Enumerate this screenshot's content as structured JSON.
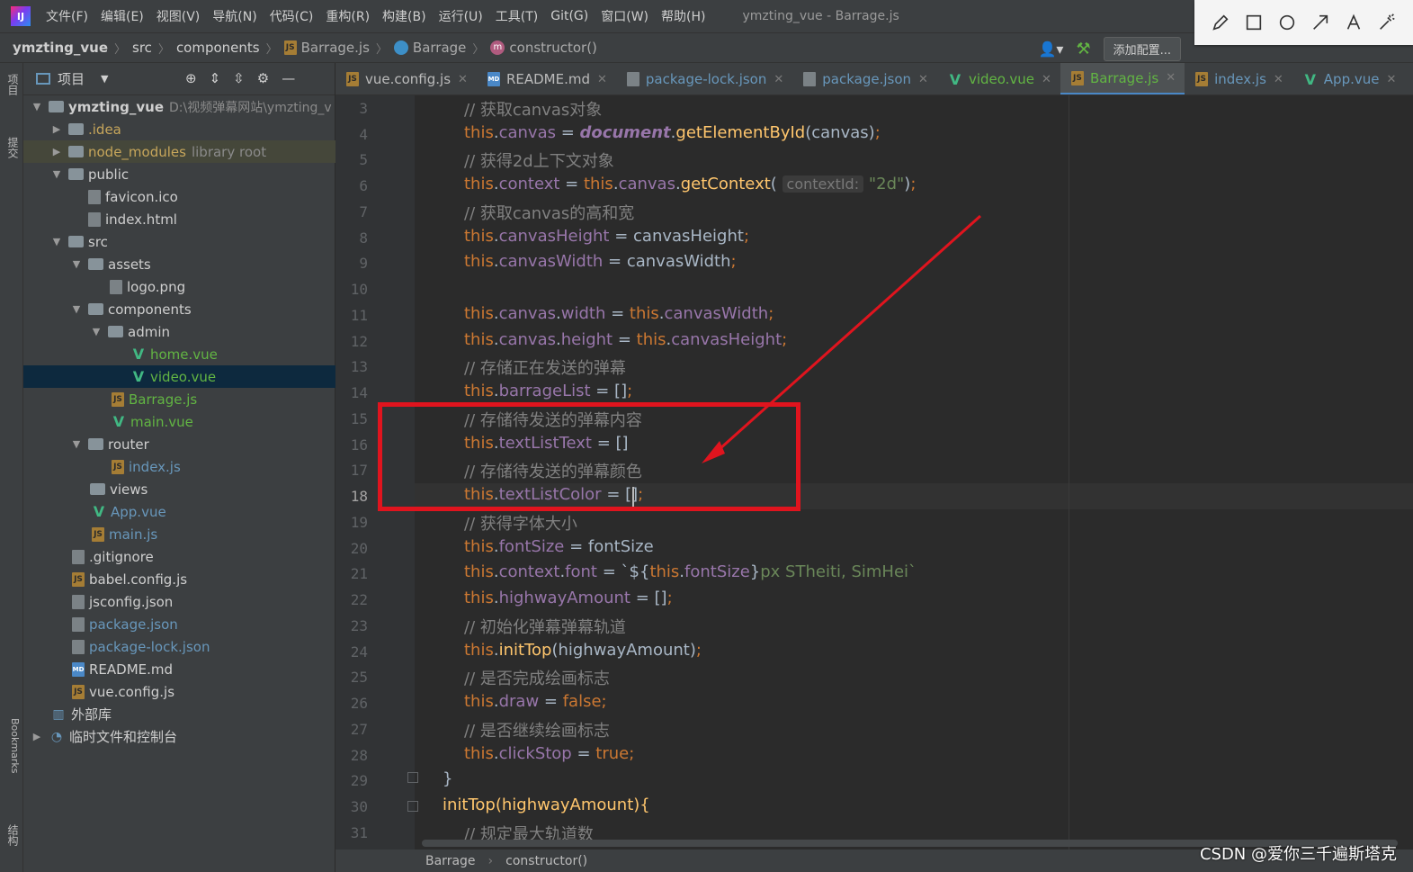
{
  "menubar": {
    "items": [
      "文件(F)",
      "编辑(E)",
      "视图(V)",
      "导航(N)",
      "代码(C)",
      "重构(R)",
      "构建(B)",
      "运行(U)",
      "工具(T)",
      "Git(G)",
      "窗口(W)",
      "帮助(H)"
    ],
    "window_title": "ymzting_vue - Barrage.js"
  },
  "navbar": {
    "crumbs": [
      "ymzting_vue",
      "src",
      "components",
      "Barrage.js",
      "Barrage",
      "constructor()"
    ],
    "add_config": "添加配置..."
  },
  "left_strip": {
    "project": "项目",
    "commit": "提交",
    "bookmarks": "Bookmarks",
    "structure": "结构"
  },
  "project_panel": {
    "title": "项目",
    "tree": [
      {
        "label": "ymzting_vue",
        "extra": "D:\\视频弹幕网站\\ymzting_v"
      },
      {
        "label": ".idea"
      },
      {
        "label": "node_modules",
        "extra": "library root"
      },
      {
        "label": "public"
      },
      {
        "label": "favicon.ico"
      },
      {
        "label": "index.html"
      },
      {
        "label": "src"
      },
      {
        "label": "assets"
      },
      {
        "label": "logo.png"
      },
      {
        "label": "components"
      },
      {
        "label": "admin"
      },
      {
        "label": "home.vue"
      },
      {
        "label": "video.vue"
      },
      {
        "label": "Barrage.js"
      },
      {
        "label": "main.vue"
      },
      {
        "label": "router"
      },
      {
        "label": "index.js"
      },
      {
        "label": "views"
      },
      {
        "label": "App.vue"
      },
      {
        "label": "main.js"
      },
      {
        "label": ".gitignore"
      },
      {
        "label": "babel.config.js"
      },
      {
        "label": "jsconfig.json"
      },
      {
        "label": "package.json"
      },
      {
        "label": "package-lock.json"
      },
      {
        "label": "README.md"
      },
      {
        "label": "vue.config.js"
      },
      {
        "label": "外部库"
      },
      {
        "label": "临时文件和控制台"
      }
    ]
  },
  "tabs": [
    "vue.config.js",
    "README.md",
    "package-lock.json",
    "package.json",
    "video.vue",
    "Barrage.js",
    "index.js",
    "App.vue"
  ],
  "editor": {
    "line_numbers": [
      "3",
      "4",
      "5",
      "6",
      "7",
      "8",
      "9",
      "10",
      "11",
      "12",
      "13",
      "14",
      "15",
      "16",
      "17",
      "18",
      "19",
      "20",
      "21",
      "22",
      "23",
      "24",
      "25",
      "26",
      "27",
      "28",
      "29",
      "30",
      "31"
    ],
    "comments": {
      "c3": "// 获取canvas对象",
      "c5": "// 获得2d上下文对象",
      "c7": "// 获取canvas的高和宽",
      "c13": "// 存储正在发送的弹幕",
      "c15": "// 存储待发送的弹幕内容",
      "c17": "// 存储待发送的弹幕颜色",
      "c19": "// 获得字体大小",
      "c23": "// 初始化弹幕弹幕轨道",
      "c25": "// 是否完成绘画标志",
      "c27": "// 是否继续绘画标志",
      "c31": "// 规定最大轨道数"
    },
    "tokens": {
      "this": "this",
      "canvas": "canvas",
      "document": "document",
      "getElementById": "getElementById",
      "canvasArg": "canvas",
      "context": "context",
      "getContext": "getContext",
      "contextIdHint": "contextId:",
      "str2d": "\"2d\"",
      "canvasHeight": "canvasHeight",
      "canvasWidth": "canvasWidth",
      "width": "width",
      "height": "height",
      "barrageList": "barrageList",
      "textListText": "textListText",
      "textListColor": "textListColor",
      "fontSize": "fontSize",
      "font": "font",
      "tplOpen": "`${",
      "tplClose": "}",
      "tplRest": "px STheiti, SimHei`",
      "highwayAmount": "highwayAmount",
      "initTop": "initTop",
      "draw": "draw",
      "false": "false",
      "clickStop": "clickStop",
      "true": "true",
      "brace": "}",
      "initTopDecl": "initTop(highwayAmount){"
    }
  },
  "bottom": {
    "crumb1": "Barrage",
    "crumb2": "constructor()"
  },
  "watermark": "CSDN @爱你三千遍斯塔克"
}
